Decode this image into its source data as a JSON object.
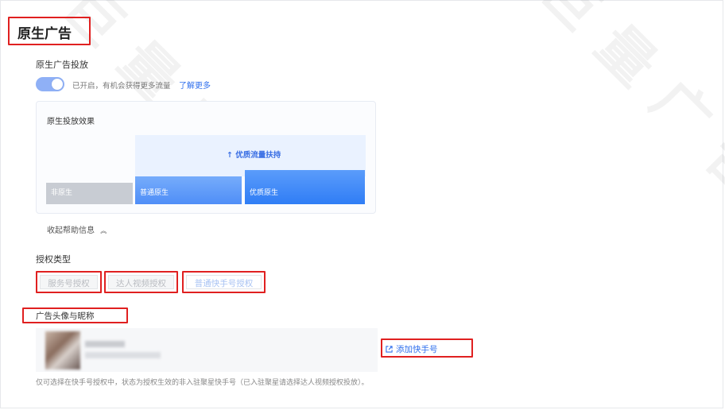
{
  "page": {
    "title": "原生广告"
  },
  "native": {
    "section_label": "原生广告投放",
    "toggle_text": "已开启，有机会获得更多流量",
    "learn_more": "了解更多"
  },
  "effect": {
    "title": "原生投放效果",
    "boost_label": "优质流量扶持",
    "bars": [
      "非原生",
      "普通原生",
      "优质原生"
    ]
  },
  "collapse_label": "收起帮助信息",
  "auth": {
    "label": "授权类型",
    "options": [
      "服务号授权",
      "达人视频授权",
      "普通快手号授权"
    ]
  },
  "avatar": {
    "label": "广告头像与昵称",
    "add_label": "添加快手号",
    "note": "仅可选择在快手号授权中，状态为授权生效的非入驻聚星快手号（已入驻聚星请选择达人视频授权投放）。"
  },
  "colors": {
    "accent": "#2f6fed",
    "highlight": "#e02020"
  }
}
